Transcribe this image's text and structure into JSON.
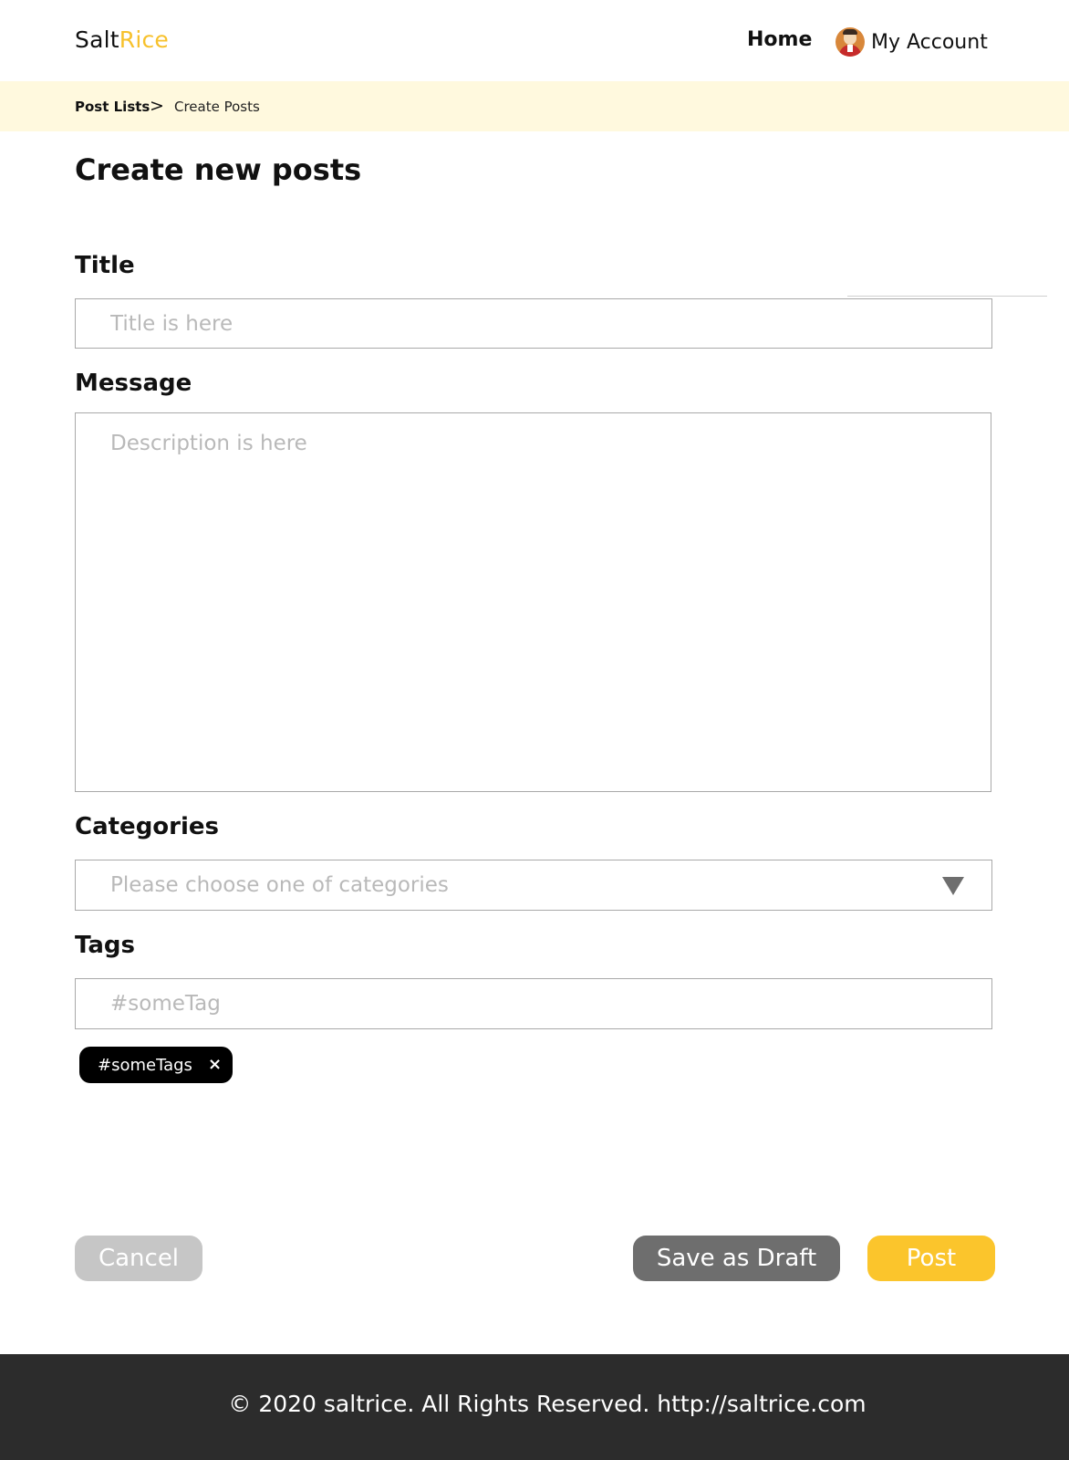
{
  "header": {
    "logo_part1": "Salt",
    "logo_part2": "Rice",
    "nav_home": "Home",
    "account_label": "My Account"
  },
  "breadcrumb": {
    "parent": "Post Lists",
    "separator": ">",
    "current": "Create Posts"
  },
  "page_title": "Create new posts",
  "form": {
    "title_label": "Title",
    "title_placeholder": "Title is here",
    "message_label": "Message",
    "message_placeholder": "Description is here",
    "categories_label": "Categories",
    "categories_placeholder": "Please choose one of categories",
    "tags_label": "Tags",
    "tags_placeholder": "#someTag",
    "tags": [
      "#someTags"
    ],
    "tag_remove_symbol": "×"
  },
  "actions": {
    "cancel": "Cancel",
    "save_draft": "Save as Draft",
    "post": "Post"
  },
  "footer": {
    "text": "© 2020 saltrice. All Rights Reserved. http://saltrice.com"
  },
  "colors": {
    "accent_yellow": "#fbc52c",
    "breadcrumb_bg": "#fff9de",
    "footer_bg": "#2c2c2c",
    "draft_gray": "#6e6e6e",
    "cancel_gray": "#c6c6c6"
  }
}
